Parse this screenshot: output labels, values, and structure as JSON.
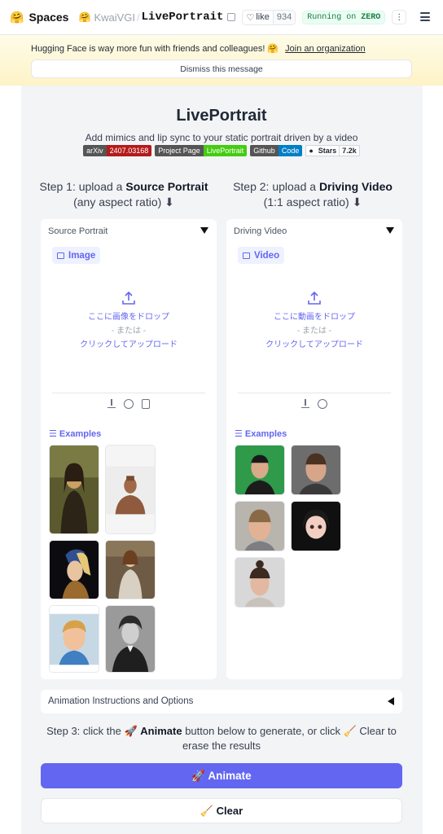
{
  "topbar": {
    "logo_emoji": "🤗",
    "spaces_label": "Spaces",
    "owner_emoji": "🤗",
    "owner": "KwaiVGI",
    "separator": "/",
    "repo": "LivePortrait",
    "like_label": "like",
    "like_count": "934",
    "running_prefix": "Running on ",
    "running_hw": "ZERO"
  },
  "banner": {
    "text": "Hugging Face is way more fun with friends and colleagues! 🤗",
    "link": "Join an organization",
    "dismiss": "Dismiss this message"
  },
  "header": {
    "title": "LivePortrait",
    "subtitle": "Add mimics and lip sync to your static portrait driven by a video",
    "badges": {
      "arxiv_left": "arXiv",
      "arxiv_right": "2407.03168",
      "project_left": "Project Page",
      "project_right": "LivePortrait",
      "github_left": "Github",
      "github_right": "Code",
      "stars_label": "Stars",
      "stars_count": "7.2k"
    }
  },
  "steps": {
    "step1_prefix": "Step 1: upload a ",
    "step1_bold": "Source Portrait",
    "step1_note": "(any aspect ratio) ⬇",
    "step2_prefix": "Step 2: upload a ",
    "step2_bold": "Driving Video",
    "step2_note": "(1:1 aspect ratio) ⬇"
  },
  "source_panel": {
    "label": "Source Portrait",
    "tab": "Image",
    "drop_line1": "ここに画像をドロップ",
    "drop_line2": "- または -",
    "drop_line3": "クリックしてアップロード",
    "examples_label": "Examples"
  },
  "driving_panel": {
    "label": "Driving Video",
    "tab": "Video",
    "drop_line1": "ここに動画をドロップ",
    "drop_line2": "- または -",
    "drop_line3": "クリックしてアップロード",
    "examples_label": "Examples"
  },
  "options": {
    "label": "Animation Instructions and Options"
  },
  "step3": {
    "prefix": "Step 3: click the 🚀 ",
    "bold": "Animate",
    "suffix": " button below to generate, or click 🧹 Clear to erase the results"
  },
  "buttons": {
    "animate": "🚀 Animate",
    "clear": "🧹 Clear"
  },
  "colors": {
    "accent": "#6366f1",
    "running_green": "#15803d",
    "banner_bg": "#fef9c3"
  }
}
